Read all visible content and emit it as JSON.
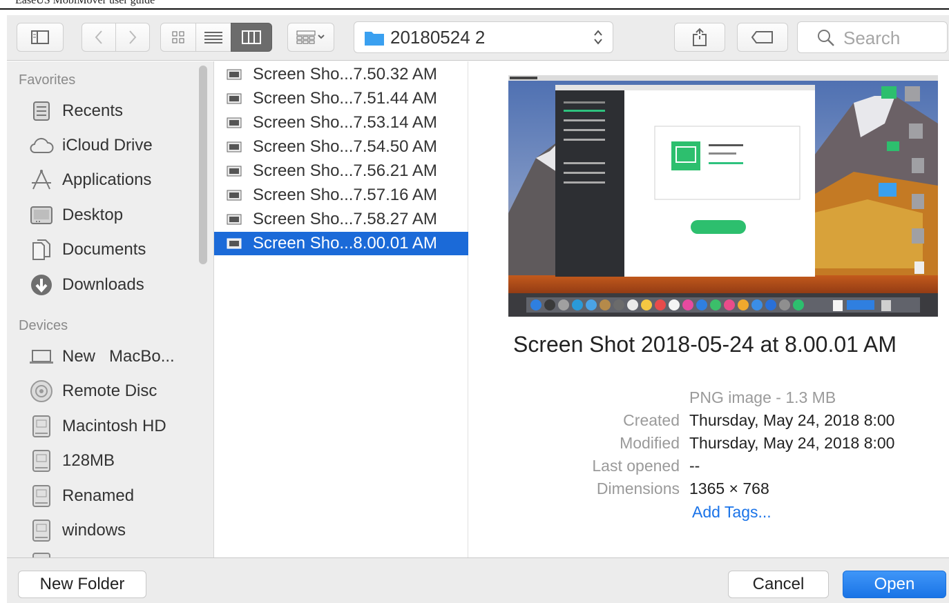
{
  "doc": {
    "header": "EaseUS MobiMover user guide"
  },
  "toolbar": {
    "path_folder": "20180524 2",
    "search_placeholder": "Search",
    "icons": [
      "sidebar-toggle-icon",
      "back-icon",
      "forward-icon",
      "icon-view-icon",
      "list-view-icon",
      "column-view-icon",
      "group-icon",
      "share-icon",
      "tag-icon",
      "search-icon"
    ]
  },
  "sidebar": {
    "favorites_heading": "Favorites",
    "favorites": [
      {
        "label": "Recents",
        "icon": "recents-icon"
      },
      {
        "label": "iCloud Drive",
        "icon": "cloud-icon"
      },
      {
        "label": "Applications",
        "icon": "applications-icon"
      },
      {
        "label": "Desktop",
        "icon": "desktop-icon"
      },
      {
        "label": "Documents",
        "icon": "documents-icon"
      },
      {
        "label": "Downloads",
        "icon": "downloads-icon"
      }
    ],
    "devices_heading": "Devices",
    "devices": [
      {
        "label": "New   MacBo...",
        "icon": "laptop-icon"
      },
      {
        "label": "Remote Disc",
        "icon": "disc-icon"
      },
      {
        "label": "Macintosh HD",
        "icon": "drive-icon"
      },
      {
        "label": "128MB",
        "icon": "drive-icon"
      },
      {
        "label": "Renamed",
        "icon": "drive-icon"
      },
      {
        "label": "windows",
        "icon": "drive-icon"
      }
    ]
  },
  "files": [
    {
      "name": "Screen Sho...7.50.32 AM",
      "selected": false
    },
    {
      "name": "Screen Sho...7.51.44 AM",
      "selected": false
    },
    {
      "name": "Screen Sho...7.53.14 AM",
      "selected": false
    },
    {
      "name": "Screen Sho...7.54.50 AM",
      "selected": false
    },
    {
      "name": "Screen Sho...7.56.21 AM",
      "selected": false
    },
    {
      "name": "Screen Sho...7.57.16 AM",
      "selected": false
    },
    {
      "name": "Screen Sho...7.58.27 AM",
      "selected": false
    },
    {
      "name": "Screen Sho...8.00.01 AM",
      "selected": true
    }
  ],
  "preview": {
    "title": "Screen Shot 2018-05-24 at 8.00.01 AM",
    "kind": "PNG image - 1.3 MB",
    "meta": [
      {
        "key": "Created",
        "value": "Thursday, May 24, 2018 8:00"
      },
      {
        "key": "Modified",
        "value": "Thursday, May 24, 2018 8:00"
      },
      {
        "key": "Last opened",
        "value": "--"
      },
      {
        "key": "Dimensions",
        "value": "1365 × 768"
      }
    ],
    "add_tags": "Add Tags..."
  },
  "buttons": {
    "new_folder": "New Folder",
    "cancel": "Cancel",
    "open": "Open"
  },
  "colors": {
    "selection": "#1b6ad8",
    "accent": "#1a73e8",
    "folder": "#3aa0f0"
  }
}
